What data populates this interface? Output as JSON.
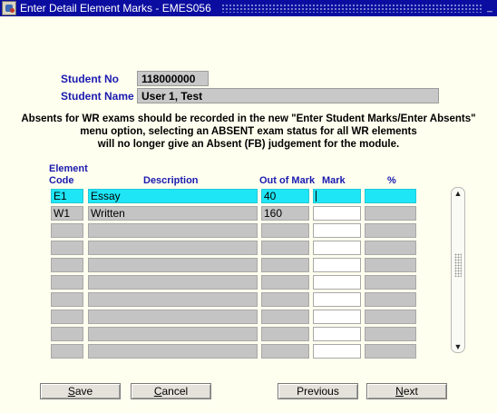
{
  "window": {
    "title": "Enter Detail Element Marks - EMES056"
  },
  "student": {
    "no_label": "Student No",
    "no_value": "118000000",
    "name_label": "Student Name",
    "name_value": "User 1, Test"
  },
  "notice": {
    "line1": "Absents for WR exams should be recorded in the new \"Enter Student Marks/Enter Absents\"",
    "line2": "menu option, selecting an ABSENT exam status for all WR elements",
    "line3": "will no longer give an Absent (FB) judgement for the module."
  },
  "table": {
    "headers": {
      "code_line1": "Element",
      "code_line2": "Code",
      "description": "Description",
      "out_of": "Out of Mark",
      "mark": "Mark",
      "percent": "%"
    },
    "rows": [
      {
        "code": "E1",
        "description": "Essay",
        "out_of": "40",
        "mark": "",
        "percent": ""
      },
      {
        "code": "W1",
        "description": "Written",
        "out_of": "160",
        "mark": "",
        "percent": ""
      },
      {
        "code": "",
        "description": "",
        "out_of": "",
        "mark": "",
        "percent": ""
      },
      {
        "code": "",
        "description": "",
        "out_of": "",
        "mark": "",
        "percent": ""
      },
      {
        "code": "",
        "description": "",
        "out_of": "",
        "mark": "",
        "percent": ""
      },
      {
        "code": "",
        "description": "",
        "out_of": "",
        "mark": "",
        "percent": ""
      },
      {
        "code": "",
        "description": "",
        "out_of": "",
        "mark": "",
        "percent": ""
      },
      {
        "code": "",
        "description": "",
        "out_of": "",
        "mark": "",
        "percent": ""
      },
      {
        "code": "",
        "description": "",
        "out_of": "",
        "mark": "",
        "percent": ""
      },
      {
        "code": "",
        "description": "",
        "out_of": "",
        "mark": "",
        "percent": ""
      }
    ]
  },
  "buttons": {
    "save_u": "S",
    "save_rest": "ave",
    "cancel_u": "C",
    "cancel_rest": "ancel",
    "previous": "Previous",
    "next_u": "N",
    "next_rest": "ext"
  },
  "colors": {
    "titlebar": "#0b0da0",
    "background": "#ffffef",
    "label_blue": "#1a1ab0",
    "selected_row": "#1fe6f6",
    "disabled_cell": "#c4c4c4"
  },
  "icons": {
    "app": "oracle-forms-icon",
    "minimize": "minimize-icon",
    "scroll_up": "scroll-up-arrow-icon",
    "scroll_down": "scroll-down-arrow-icon"
  }
}
